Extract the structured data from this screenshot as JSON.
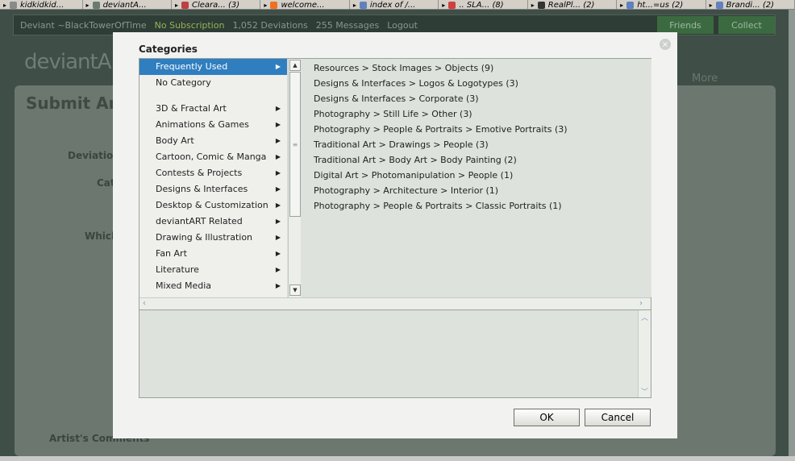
{
  "browser_tabs": [
    {
      "label": "kidkidkid...",
      "icon": "page-icon",
      "color": "#8a8a8a"
    },
    {
      "label": "deviantA...",
      "icon": "deviantart-icon",
      "color": "#6a7a70"
    },
    {
      "label": "Cleara... (3)",
      "icon": "page-icon",
      "color": "#c04040"
    },
    {
      "label": "welcome...",
      "icon": "blogger-icon",
      "color": "#f07020"
    },
    {
      "label": "index of /...",
      "icon": "page-icon",
      "color": "#6080c0"
    },
    {
      "label": ".. SLA... (8)",
      "icon": "page-icon",
      "color": "#d04040"
    },
    {
      "label": "RealPl... (2)",
      "icon": "wikipedia-icon",
      "color": "#333333"
    },
    {
      "label": "ht...=us (2)",
      "icon": "page-icon",
      "color": "#6080c0"
    },
    {
      "label": "Brandi... (2)",
      "icon": "page-icon",
      "color": "#6080c0"
    }
  ],
  "background": {
    "userbar": {
      "user": "Deviant ~BlackTowerOfTime",
      "subscription": "No Subscription",
      "deviations": "1,052 Deviations",
      "messages": "255 Messages",
      "logout": "Logout",
      "friends": "Friends",
      "collect": "Collect"
    },
    "logo": "deviantART",
    "more": "More",
    "submit_title": "Submit Art",
    "labels": [
      "Deviatio",
      "Cat",
      "Which"
    ],
    "artist_comments": "Artist's Comments"
  },
  "modal": {
    "title": "Categories",
    "close_symbol": "×",
    "left_items": [
      {
        "label": "Frequently Used",
        "selected": true,
        "has_sub": true
      },
      {
        "label": "No Category",
        "selected": false,
        "has_sub": false
      },
      {
        "label": "",
        "spacer": true
      },
      {
        "label": "3D & Fractal Art",
        "selected": false,
        "has_sub": true
      },
      {
        "label": "Animations & Games",
        "selected": false,
        "has_sub": true
      },
      {
        "label": "Body Art",
        "selected": false,
        "has_sub": true
      },
      {
        "label": "Cartoon, Comic & Manga",
        "selected": false,
        "has_sub": true
      },
      {
        "label": "Contests & Projects",
        "selected": false,
        "has_sub": true
      },
      {
        "label": "Designs & Interfaces",
        "selected": false,
        "has_sub": true
      },
      {
        "label": "Desktop & Customization",
        "selected": false,
        "has_sub": true
      },
      {
        "label": "deviantART Related",
        "selected": false,
        "has_sub": true
      },
      {
        "label": "Drawing & Illustration",
        "selected": false,
        "has_sub": true
      },
      {
        "label": "Fan Art",
        "selected": false,
        "has_sub": true
      },
      {
        "label": "Literature",
        "selected": false,
        "has_sub": true
      },
      {
        "label": "Mixed Media",
        "selected": false,
        "has_sub": true
      }
    ],
    "right_items": [
      "Resources > Stock Images > Objects (9)",
      "Designs & Interfaces > Logos & Logotypes (3)",
      "Designs & Interfaces > Corporate (3)",
      "Photography > Still Life > Other (3)",
      "Photography > People & Portraits > Emotive Portraits (3)",
      "Traditional Art > Drawings > People (3)",
      "Traditional Art > Body Art > Body Painting (2)",
      "Digital Art > Photomanipulation > People (1)",
      "Photography > Architecture > Interior (1)",
      "Photography > People & Portraits > Classic Portraits (1)"
    ],
    "ok_label": "OK",
    "cancel_label": "Cancel"
  },
  "colors": {
    "selected": "#2f7ec0",
    "overlay": "#3f4e46"
  }
}
